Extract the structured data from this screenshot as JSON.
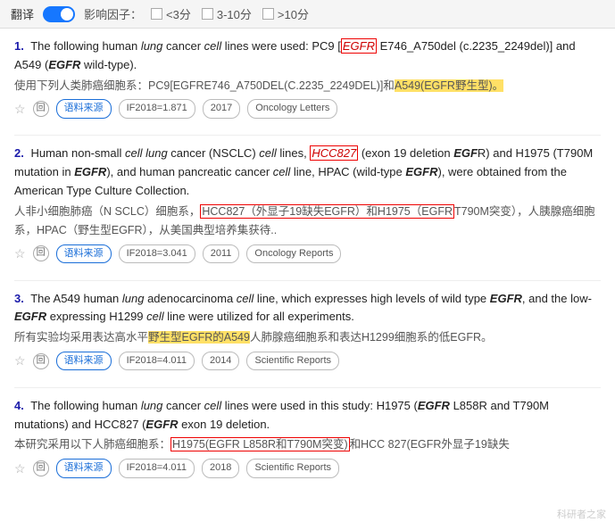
{
  "topbar": {
    "toggle_label": "翻译",
    "filter_label": "影响因子：",
    "filters": [
      {
        "label": "<3分",
        "checked": false
      },
      {
        "label": "3-10分",
        "checked": false
      },
      {
        "label": ">10分",
        "checked": false
      }
    ]
  },
  "results": [
    {
      "number": "1.",
      "en_parts": [
        {
          "text": "The following human ",
          "style": "normal"
        },
        {
          "text": "lung",
          "style": "italic"
        },
        {
          "text": " cancer ",
          "style": "normal"
        },
        {
          "text": "cell",
          "style": "italic"
        },
        {
          "text": " lines were used: PC9 [",
          "style": "normal"
        },
        {
          "text": "EGFR",
          "style": "highlight-red-border"
        },
        {
          "text": " E746_A750del (c.2235_2249del)] and A549 (",
          "style": "normal"
        },
        {
          "text": "EGFR",
          "style": "italic-bold"
        },
        {
          "text": " wild-type).",
          "style": "normal"
        }
      ],
      "zh_parts": [
        {
          "text": "使用下列人类肺癌细胞系：PC9[EGFRE746_A750DEL(C.2235_2249DEL)]和",
          "style": "normal"
        },
        {
          "text": "A549(EGFR野生型)。",
          "style": "zh-highlight-yellow"
        }
      ],
      "meta": {
        "if_value": "IF2018=1.871",
        "year": "2017",
        "journal": "Oncology Letters"
      }
    },
    {
      "number": "2.",
      "en_parts": [
        {
          "text": "Human non-small ",
          "style": "normal"
        },
        {
          "text": "cell",
          "style": "italic"
        },
        {
          "text": " ",
          "style": "normal"
        },
        {
          "text": "lung",
          "style": "italic"
        },
        {
          "text": " cancer (NSCLC) ",
          "style": "normal"
        },
        {
          "text": "cell",
          "style": "italic"
        },
        {
          "text": " lines, ",
          "style": "normal"
        },
        {
          "text": "HCC827",
          "style": "zh-highlight-red-border"
        },
        {
          "text": " (exon 19 deletion ",
          "style": "normal"
        },
        {
          "text": "EGF",
          "style": "italic-bold"
        },
        {
          "text": "R) and H1975 (T790M mutation in ",
          "style": "normal"
        },
        {
          "text": "EGFR",
          "style": "italic-bold"
        },
        {
          "text": "), and human pancreatic cancer ",
          "style": "normal"
        },
        {
          "text": "cell",
          "style": "italic"
        },
        {
          "text": " line, HPAC (wild-type ",
          "style": "normal"
        },
        {
          "text": "EGFR",
          "style": "italic-bold"
        },
        {
          "text": "), were obtained from the American Type Culture Collection.",
          "style": "normal"
        }
      ],
      "zh_parts": [
        {
          "text": "人非小细胞肺癌（N SCLC）细胞系，",
          "style": "normal"
        },
        {
          "text": "HCC827（外显子19缺失EGFR）和H1975（EGFR",
          "style": "zh-highlight-red-border"
        },
        {
          "text": "T790M突变），人胰腺癌细胞系，HPAC（野生型EGFR），从美国典型培养集获待..",
          "style": "normal"
        }
      ],
      "meta": {
        "if_value": "IF2018=3.041",
        "year": "2011",
        "journal": "Oncology Reports"
      }
    },
    {
      "number": "3.",
      "en_parts": [
        {
          "text": "The A549 human ",
          "style": "normal"
        },
        {
          "text": "lung",
          "style": "italic"
        },
        {
          "text": " adenocarcinoma ",
          "style": "normal"
        },
        {
          "text": "cell",
          "style": "italic"
        },
        {
          "text": " line, which expresses high levels of wild type ",
          "style": "normal"
        },
        {
          "text": "EGFR",
          "style": "italic-bold"
        },
        {
          "text": ", and the low-",
          "style": "normal"
        },
        {
          "text": "EGFR",
          "style": "italic-bold"
        },
        {
          "text": " expressing H1299 ",
          "style": "normal"
        },
        {
          "text": "cell",
          "style": "italic"
        },
        {
          "text": " line were utilized for all experiments.",
          "style": "normal"
        }
      ],
      "zh_parts": [
        {
          "text": "所有实验均采用表达高水平",
          "style": "normal"
        },
        {
          "text": "野生型EGFR的A549",
          "style": "zh-highlight-yellow"
        },
        {
          "text": "人肺腺癌细胞系和表达H1299细胞系的低EGFR。",
          "style": "normal"
        }
      ],
      "meta": {
        "if_value": "IF2018=4.011",
        "year": "2014",
        "journal": "Scientific Reports"
      }
    },
    {
      "number": "4.",
      "en_parts": [
        {
          "text": "The following human ",
          "style": "normal"
        },
        {
          "text": "lung",
          "style": "italic"
        },
        {
          "text": " cancer ",
          "style": "normal"
        },
        {
          "text": "cell",
          "style": "italic"
        },
        {
          "text": " lines were used in this study: H1975 (",
          "style": "normal"
        },
        {
          "text": "EGFR",
          "style": "italic-bold"
        },
        {
          "text": " L858R and T790M mutations) and HCC827 (",
          "style": "normal"
        },
        {
          "text": "EGFR",
          "style": "italic-bold"
        },
        {
          "text": " exon 19 deletion.",
          "style": "normal"
        }
      ],
      "zh_parts": [
        {
          "text": "本研究采用以下人肺癌细胞系：",
          "style": "normal"
        },
        {
          "text": "H1975(EGFR L858R和T790M突变)",
          "style": "zh-highlight-red-border"
        },
        {
          "text": "和HCC 827(EGFR外显子19缺失",
          "style": "normal"
        }
      ],
      "meta": {
        "if_value": "IF2018=4.011",
        "year": "2018",
        "journal": "Scientific Reports"
      }
    }
  ],
  "watermark": "科研者之家"
}
